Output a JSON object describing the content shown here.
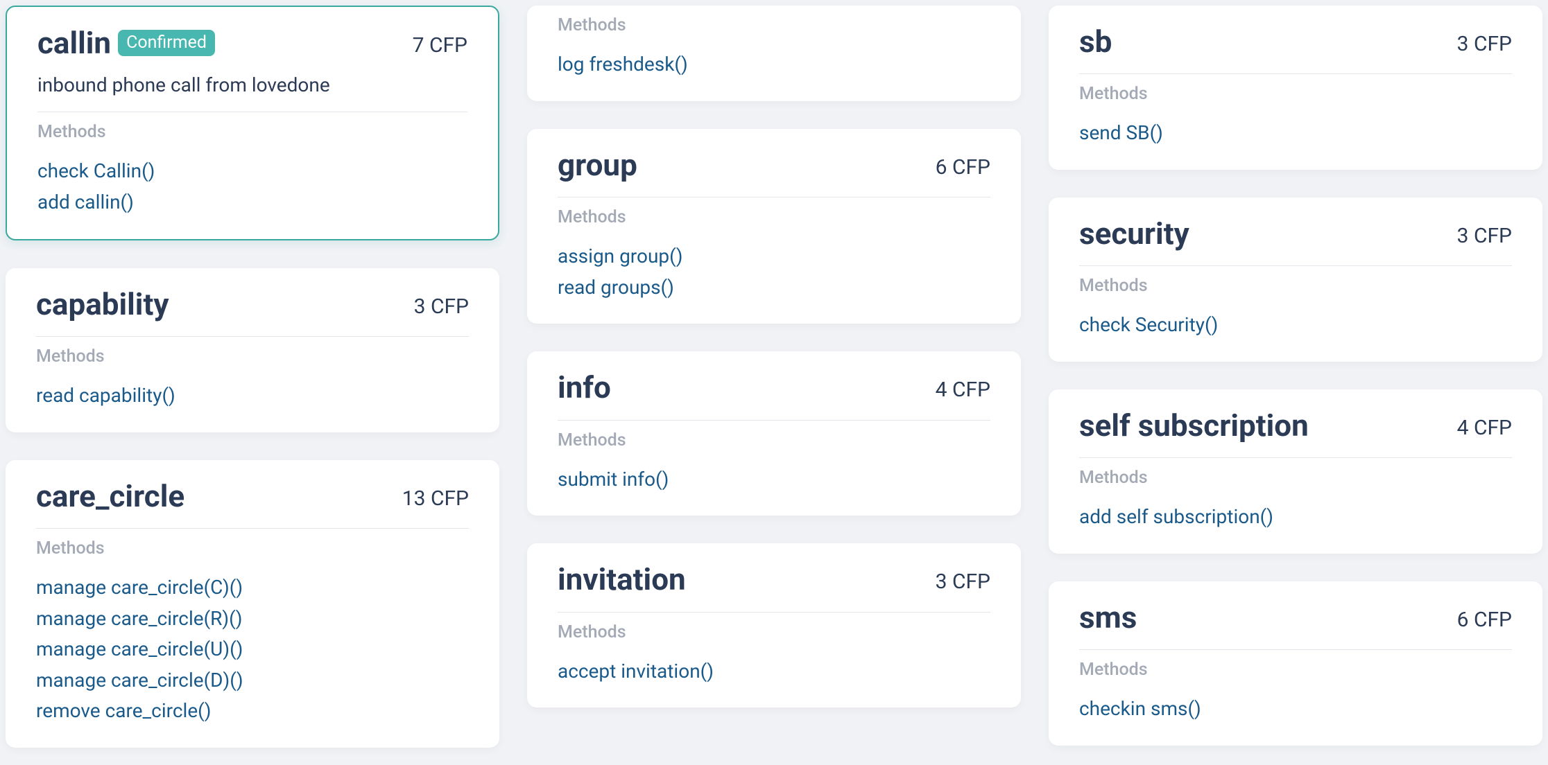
{
  "labels": {
    "methods": "Methods",
    "cfp_suffix": "CFP"
  },
  "cols": [
    [
      {
        "title": "callin",
        "badge": "Confirmed",
        "selected": true,
        "description": "inbound phone call from lovedone",
        "cfp": "7",
        "methods": [
          "check Callin()",
          "add callin()"
        ]
      },
      {
        "title": "capability",
        "cfp": "3",
        "methods": [
          "read capability()"
        ]
      },
      {
        "title": "care_circle",
        "cfp": "13",
        "methods": [
          "manage care_circle(C)()",
          "manage care_circle(R)()",
          "manage care_circle(U)()",
          "manage care_circle(D)()",
          "remove care_circle()"
        ]
      }
    ],
    [
      {
        "partial_top": true,
        "methods": [
          "log freshdesk()"
        ]
      },
      {
        "title": "group",
        "cfp": "6",
        "methods": [
          "assign group()",
          "read groups()"
        ]
      },
      {
        "title": "info",
        "cfp": "4",
        "methods": [
          "submit info()"
        ]
      },
      {
        "title": "invitation",
        "cfp": "3",
        "methods": [
          "accept invitation()"
        ]
      }
    ],
    [
      {
        "title": "sb",
        "cfp": "3",
        "methods": [
          "send SB()"
        ]
      },
      {
        "title": "security",
        "cfp": "3",
        "methods": [
          "check Security()"
        ]
      },
      {
        "title": "self subscription",
        "cfp": "4",
        "methods": [
          "add self subscription()"
        ]
      },
      {
        "title": "sms",
        "cfp": "6",
        "methods": [
          "checkin sms()"
        ]
      }
    ]
  ]
}
